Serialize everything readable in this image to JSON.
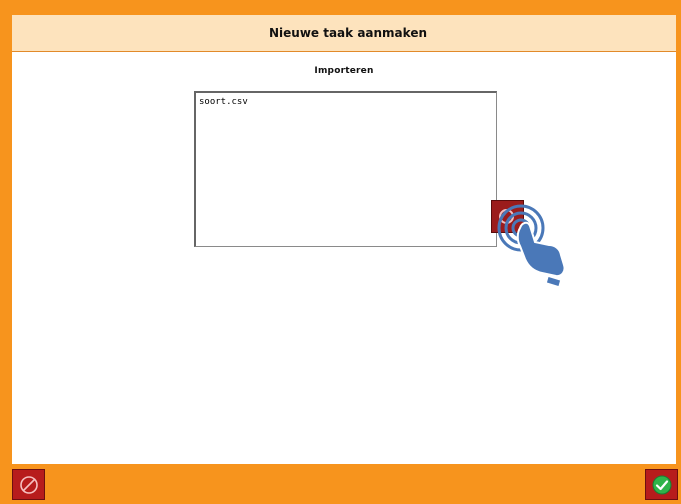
{
  "header": {
    "title": "Nieuwe taak aanmaken"
  },
  "import": {
    "section_label": "Importeren",
    "files": [
      "soort.csv"
    ]
  },
  "icons": {
    "import_button": "import-icon",
    "tap_hint": "tap-gesture-icon",
    "cancel": "no-entry-icon",
    "confirm": "check-icon"
  },
  "colors": {
    "frame": "#f7941d",
    "titlebar": "#fde3bd",
    "button": "#b71c1c",
    "hint": "#4a78b8",
    "confirm": "#2fb34a"
  }
}
